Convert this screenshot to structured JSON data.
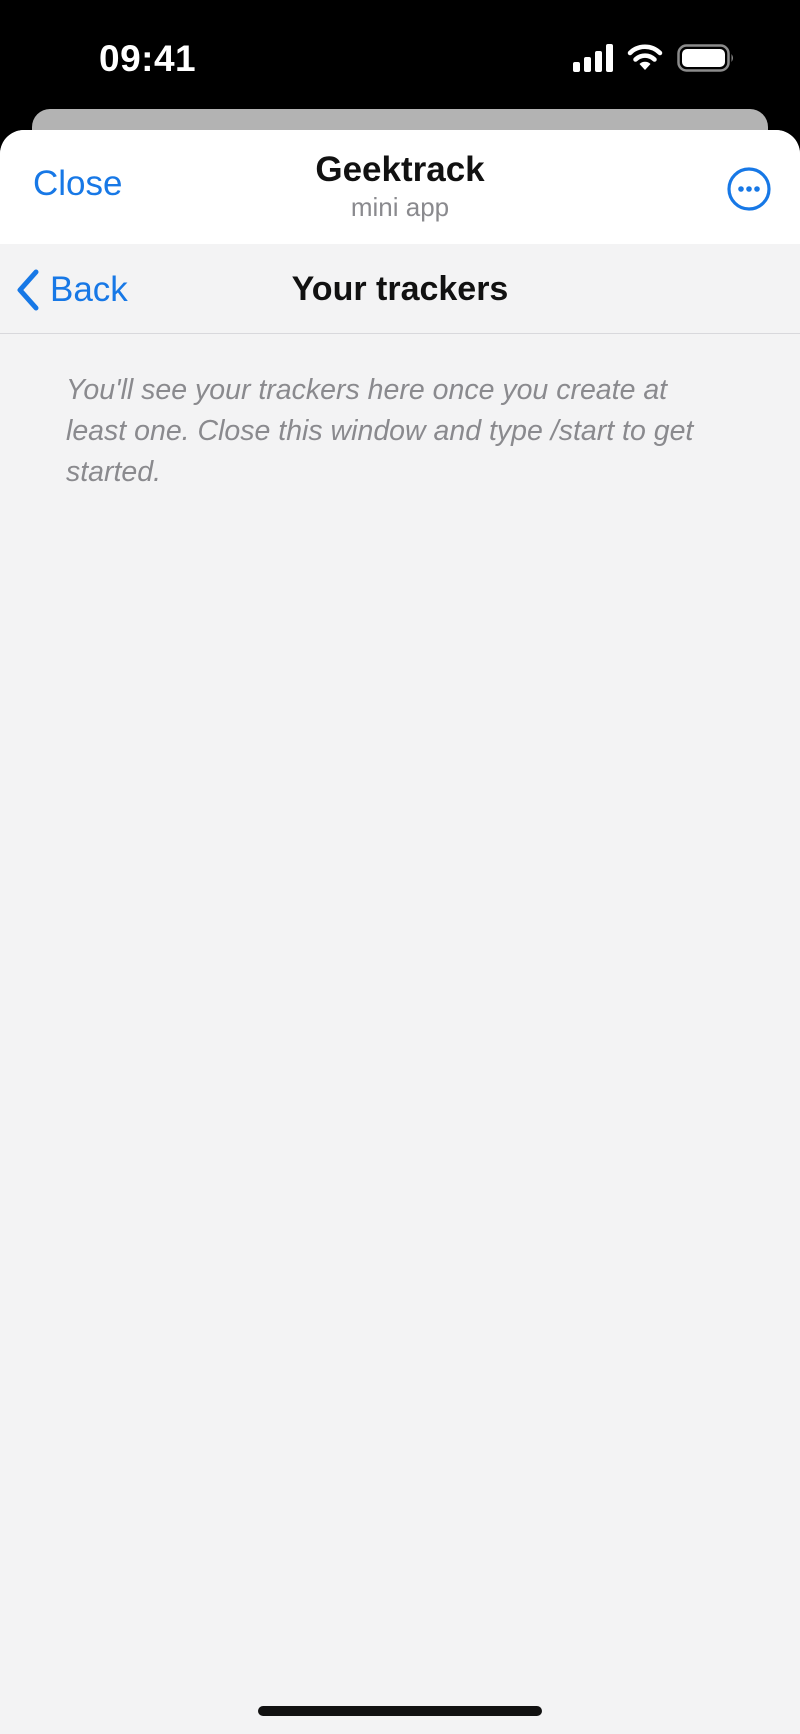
{
  "status_bar": {
    "time": "09:41",
    "icons": [
      "signal-icon",
      "wifi-icon",
      "battery-icon"
    ]
  },
  "header": {
    "close_label": "Close",
    "title": "Geektrack",
    "subtitle": "mini app",
    "more_icon": "ellipsis-circle-icon"
  },
  "nav": {
    "back_label": "Back",
    "title": "Your trackers"
  },
  "content": {
    "empty_message": "You'll see your trackers here once you create at least one. Close this window and type /start to get started."
  },
  "colors": {
    "accent": "#1778e6",
    "background": "#f3f3f4",
    "header_background": "#ffffff",
    "secondary_text": "#8a8a8e"
  }
}
